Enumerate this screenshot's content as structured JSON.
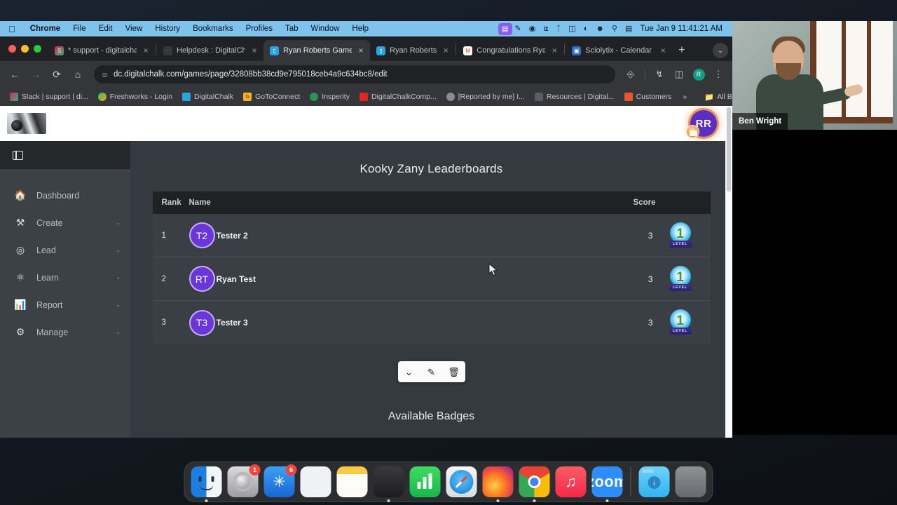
{
  "menubar": {
    "apple_icon": "apple-icon",
    "items": [
      "Chrome",
      "File",
      "Edit",
      "View",
      "History",
      "Bookmarks",
      "Profiles",
      "Tab",
      "Window",
      "Help"
    ],
    "tray_icons": [
      "control-center-icon",
      "pencil-icon",
      "screen-record-icon",
      "headphones-icon",
      "bluetooth-icon",
      "battery-icon",
      "wifi-icon",
      "user-switch-icon",
      "spotlight-search-icon",
      "display-mirror-icon"
    ],
    "clock": "Tue Jan 9  11:41:21 AM"
  },
  "browser": {
    "tabs": [
      {
        "title": "* support - digitalchalk",
        "favicon": "slack-icon",
        "active": false,
        "close": "×"
      },
      {
        "title": "Helpdesk : DigitalChalk",
        "favicon": "helpdesk-icon",
        "active": false,
        "close": "×"
      },
      {
        "title": "Ryan Roberts Games",
        "favicon": "digitalchalk-icon",
        "active": true,
        "close": "×"
      },
      {
        "title": "Ryan Roberts",
        "favicon": "digitalchalk-icon",
        "active": false,
        "close": "×"
      },
      {
        "title": "Congratulations Ryan,",
        "favicon": "gmail-icon",
        "active": false,
        "close": "×"
      },
      {
        "title": "Sciolytix - Calendar - J",
        "favicon": "calendar-icon",
        "active": false,
        "close": "×"
      }
    ],
    "new_tab_label": "+",
    "tab_list_chevron": "⌄",
    "nav": {
      "back": "←",
      "forward": "→",
      "reload": "⟳",
      "home": "⌂"
    },
    "omnibox": {
      "site_icon": "site-settings-icon",
      "url": "dc.digitalchalk.com/games/page/32808bb38cd9e795018ceb4a9c634bc8/edit",
      "bookmark_star": "☆"
    },
    "toolbar_icons": [
      "extensions-icon",
      "downloads-icon",
      "side-panel-icon"
    ],
    "profile_initial": "R",
    "menu_icon": "⋮",
    "bookmarks": [
      {
        "label": "Slack | support | di...",
        "icon": "slack-icon"
      },
      {
        "label": "Freshworks - Login",
        "icon": "freshworks-icon"
      },
      {
        "label": "DigitalChalk",
        "icon": "digitalchalk-icon"
      },
      {
        "label": "GoToConnect",
        "icon": "gotoconnect-icon"
      },
      {
        "label": "Insperity",
        "icon": "insperity-icon"
      },
      {
        "label": "DigitalChalkComp...",
        "icon": "youtube-icon"
      },
      {
        "label": "[Reported by me] I...",
        "icon": "jira-icon"
      },
      {
        "label": "Resources | Digital...",
        "icon": "resources-icon"
      },
      {
        "label": "Customers",
        "icon": "customers-icon"
      }
    ],
    "bookmarks_overflow": "»",
    "all_bookmarks": "All Bookmarks",
    "all_bookmarks_icon": "folder-icon"
  },
  "app": {
    "logo_alt": "company-logo",
    "user_avatar_initials": "RR",
    "sidebar": {
      "collapse_icon": "panel-toggle-icon",
      "items": [
        {
          "label": "Dashboard",
          "icon": "home-icon",
          "expandable": false
        },
        {
          "label": "Create",
          "icon": "tools-icon",
          "expandable": true
        },
        {
          "label": "Lead",
          "icon": "target-icon",
          "expandable": true
        },
        {
          "label": "Learn",
          "icon": "brain-icon",
          "expandable": true
        },
        {
          "label": "Report",
          "icon": "bar-chart-icon",
          "expandable": true
        },
        {
          "label": "Manage",
          "icon": "gear-icon",
          "expandable": true
        }
      ],
      "chevron": "⌄"
    },
    "leaderboard": {
      "title": "Kooky Zany Leaderboards",
      "columns": [
        "Rank",
        "Name",
        "Score"
      ],
      "rows": [
        {
          "rank": "1",
          "initials": "T2",
          "name": "Tester 2",
          "score": "3",
          "badge_level": "1",
          "badge_label": "LEVEL"
        },
        {
          "rank": "2",
          "initials": "RT",
          "name": "Ryan Test",
          "score": "3",
          "badge_level": "1",
          "badge_label": "LEVEL"
        },
        {
          "rank": "3",
          "initials": "T3",
          "name": "Tester 3",
          "score": "3",
          "badge_level": "1",
          "badge_label": "LEVEL"
        }
      ],
      "toolbar": [
        {
          "icon": "chevron-down-icon",
          "glyph": "⌄"
        },
        {
          "icon": "edit-icon",
          "glyph": "✎"
        },
        {
          "icon": "trash-icon",
          "glyph": "🗑"
        }
      ]
    },
    "next_section_title": "Available Badges"
  },
  "webcam": {
    "participant_name": "Ben Wright"
  },
  "dock": {
    "items": [
      {
        "name": "finder",
        "label": "Finder",
        "badge": null,
        "running": true
      },
      {
        "name": "system-settings",
        "label": "System Settings",
        "badge": "1",
        "running": false
      },
      {
        "name": "app-store",
        "label": "App Store",
        "badge": "6",
        "running": false
      },
      {
        "name": "launchpad",
        "label": "Launchpad",
        "badge": null,
        "running": false
      },
      {
        "name": "notes",
        "label": "Notes",
        "badge": null,
        "running": false
      },
      {
        "name": "calculator",
        "label": "Calculator",
        "badge": null,
        "running": true
      },
      {
        "name": "numbers",
        "label": "Numbers",
        "badge": null,
        "running": false
      },
      {
        "name": "safari",
        "label": "Safari",
        "badge": null,
        "running": false
      },
      {
        "name": "firefox",
        "label": "Firefox",
        "badge": null,
        "running": true
      },
      {
        "name": "chrome",
        "label": "Google Chrome",
        "badge": null,
        "running": true
      },
      {
        "name": "music",
        "label": "Music",
        "badge": null,
        "running": false
      },
      {
        "name": "zoom",
        "label": "zoom",
        "badge": null,
        "running": true
      }
    ],
    "right_items": [
      {
        "name": "downloads-folder",
        "label": "Downloads"
      },
      {
        "name": "trash",
        "label": "Trash"
      }
    ]
  },
  "colors": {
    "menubar_bg": "#7fc3ed",
    "chrome_bg": "#202124",
    "page_bg": "#343a3f",
    "table_header_bg": "#1f2124",
    "table_row_bg": "#393f44",
    "avatar_purple": "#6a36d9",
    "accent_orange": "#e87c36",
    "badge_red": "#f6453d"
  }
}
